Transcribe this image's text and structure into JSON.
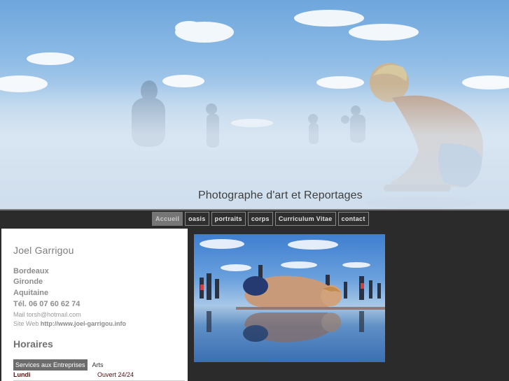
{
  "banner": {
    "title": "Photographe d'art et Reportages"
  },
  "nav": {
    "items": [
      {
        "label": "Accueil",
        "active": true
      },
      {
        "label": "oasis",
        "active": false
      },
      {
        "label": "portraits",
        "active": false
      },
      {
        "label": "corps",
        "active": false
      },
      {
        "label": "Curriculum Vitae",
        "active": false
      },
      {
        "label": "contact",
        "active": false
      }
    ]
  },
  "profile": {
    "name": "Joel Garrigou",
    "city": "Bordeaux",
    "department": "Gironde",
    "region": "Aquitaine",
    "phone": "Tél. 06 07 60 62 74",
    "mail_label": "Mail",
    "mail": "torsh@hotmail.com",
    "web_label": "Site Web",
    "web": "http://www.joel-garrigou.info"
  },
  "schedule": {
    "title": "Horaires",
    "tabs": [
      {
        "label": "Services aux Entreprises",
        "active": true
      },
      {
        "label": "Arts",
        "active": false
      }
    ],
    "rows": [
      {
        "day": "Lundi",
        "hours": "Ouvert 24/24"
      }
    ]
  },
  "colors": {
    "page_bg": "#2b2b2b",
    "nav_active": "#767676",
    "panel_bg": "#ffffff"
  }
}
